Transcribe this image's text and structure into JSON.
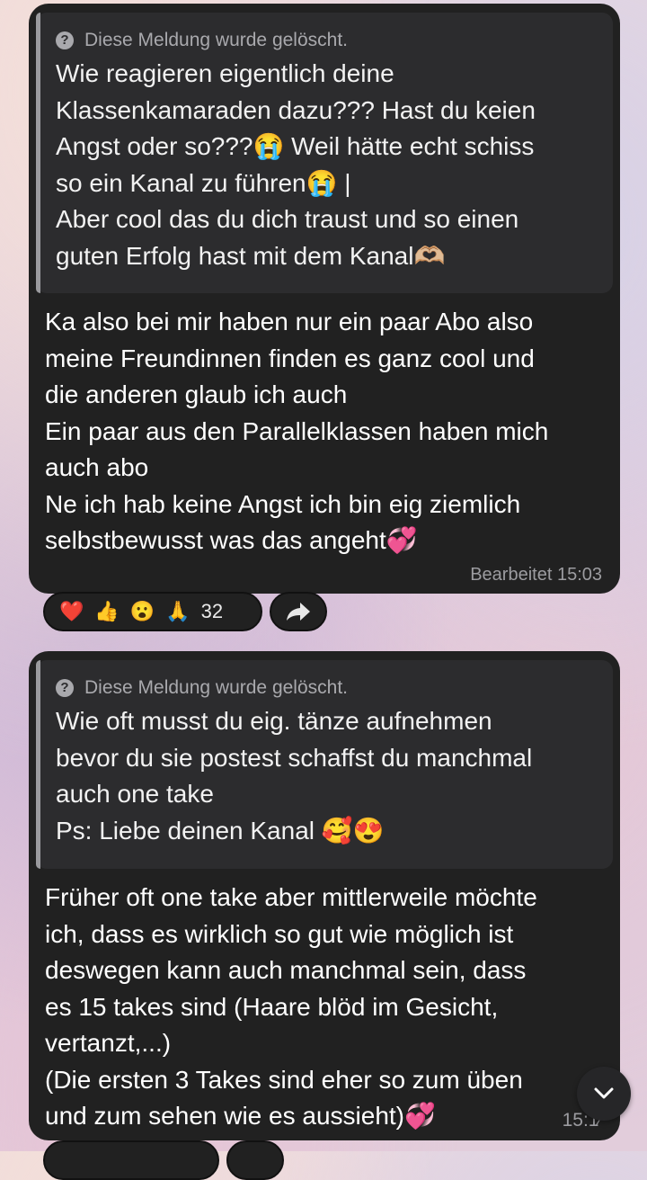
{
  "messages": [
    {
      "quote": {
        "deleted_label": "Diese Meldung wurde gelöscht.",
        "text": "Wie reagieren eigentlich deine\nKlassenkamaraden dazu??? Hast du keien\nAngst oder so???😭 Weil hätte echt schiss\nso ein Kanal zu führen😭 |\nAber cool das du dich traust und so einen\nguten Erfolg hast mit dem Kanal🫶🏼"
      },
      "text": "Ka also bei mir haben nur ein paar Abo also\nmeine Freundinnen finden es ganz cool und\ndie anderen glaub ich auch\nEin paar aus den Parallelklassen haben mich\nauch abo\nNe ich hab keine Angst ich bin eig ziemlich\nselbstbewusst was das angeht💞",
      "meta": "Bearbeitet 15:03",
      "reactions": {
        "emojis": [
          "❤️",
          "👍",
          "😮",
          "🙏"
        ],
        "count": "32"
      }
    },
    {
      "quote": {
        "deleted_label": "Diese Meldung wurde gelöscht.",
        "text": "Wie oft musst du eig. tänze aufnehmen\nbevor du sie postest schaffst du manchmal\nauch one take\nPs: Liebe deinen Kanal 🥰😍"
      },
      "text": "Früher oft one take aber mittlerweile möchte\nich, dass es wirklich so gut wie möglich ist\ndeswegen kann auch manchmal sein, dass\nes 15 takes sind (Haare blöd im Gesicht,\nvertanzt,...)\n(Die ersten 3 Takes sind eher so zum üben\nund zum sehen wie es aussieht)💞",
      "meta": "15:1⁄"
    }
  ],
  "icons": {
    "deleted": "question-circle-icon",
    "forward": "share-arrow-icon",
    "scroll_down": "chevron-down-icon"
  }
}
